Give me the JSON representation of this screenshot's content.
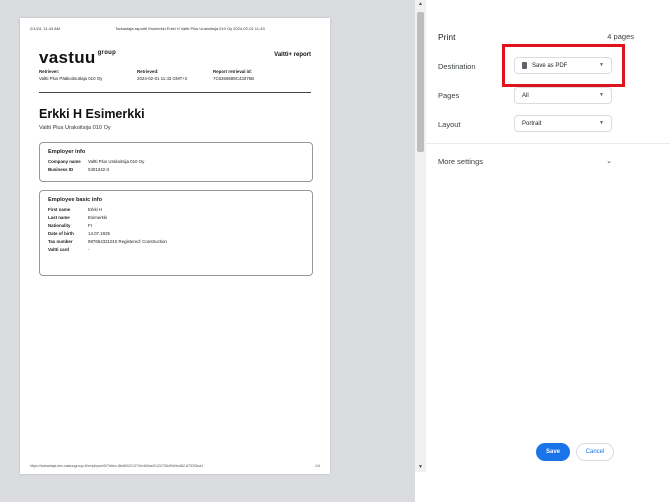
{
  "preview": {
    "header_left": "2/1/24, 11:43 AM",
    "header_center": "Tarkastaja-raportti Esimerkki Erkki H Valtti Plus Urakoitsija 010 Oy 2024-02-01 11-43",
    "logo": "vastuu",
    "logo_sup": "group",
    "report_tag": "Valtti+ report",
    "meta": [
      {
        "label": "Retriever:",
        "value": "Valtti Plus Pääkoitsuttaja 010 Oy"
      },
      {
        "label": "Retrieved:",
        "value": "2024-02-01 11:43 GMT+2"
      },
      {
        "label": "Report retrieval id:",
        "value": "7C6366589C43375B"
      }
    ],
    "person_name": "Erkki H Esimerkki",
    "person_company": "Valtti Plus Urakoitsija 010 Oy",
    "employer_info": {
      "title": "Employer info",
      "rows": [
        {
          "k": "Company name",
          "v": "Valtti Plus Urakoitsija 010 Oy"
        },
        {
          "k": "Business ID",
          "v": "0401342-3"
        }
      ]
    },
    "basic_info": {
      "title": "Employee basic info",
      "rows": [
        {
          "k": "First name",
          "v": "Erkki H"
        },
        {
          "k": "Last name",
          "v": "Esimerkki"
        },
        {
          "k": "Nationality",
          "v": "FI"
        },
        {
          "k": "Date of birth",
          "v": "14.07.1925"
        },
        {
          "k": "Tax number",
          "v": "987654321010 Registered: Construction"
        },
        {
          "k": "Valtti card",
          "v": "-"
        }
      ]
    },
    "footer_url": "https://tarkastaja.dev.vastuugroup.fi/employee/5/7b6ec-8bd6022137/0e4b5ae01/2073649/b9ed82-8792f3ea1",
    "footer_page": "1/4"
  },
  "settings": {
    "title": "Print",
    "sheet_count": "4 pages",
    "destination_label": "Destination",
    "destination_value": "Save as PDF",
    "pages_label": "Pages",
    "pages_value": "All",
    "layout_label": "Layout",
    "layout_value": "Portrait",
    "more_settings": "More settings",
    "save_label": "Save",
    "cancel_label": "Cancel",
    "highlight_color": "#e0121b",
    "accent_color": "#1a73e8"
  }
}
